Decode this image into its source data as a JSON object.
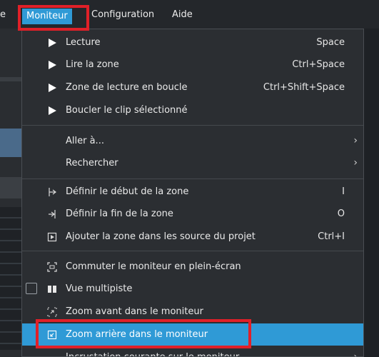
{
  "menubar": {
    "prev_label": "e",
    "active_label": "Moniteur",
    "config_label": "Configuration",
    "aide_label": "Aide"
  },
  "menu": {
    "items": [
      {
        "label": "Lecture",
        "shortcut": "Space",
        "icon": "play-icon"
      },
      {
        "label": "Lire la zone",
        "shortcut": "Ctrl+Space",
        "icon": "play-icon"
      },
      {
        "label": "Zone de lecture en boucle",
        "shortcut": "Ctrl+Shift+Space",
        "icon": "play-icon"
      },
      {
        "label": "Boucler le clip sélectionné",
        "shortcut": "",
        "icon": "play-icon"
      },
      {
        "label": "Aller à...",
        "submenu": true
      },
      {
        "label": "Rechercher",
        "submenu": true
      },
      {
        "label": "Définir le début de la zone",
        "shortcut": "I",
        "icon": "zone-start-icon"
      },
      {
        "label": "Définir la fin de la zone",
        "shortcut": "O",
        "icon": "zone-end-icon"
      },
      {
        "label": "Ajouter la zone dans les source du projet",
        "shortcut": "Ctrl+I",
        "icon": "add-zone-icon"
      },
      {
        "label": "Commuter le moniteur en plein-écran",
        "icon": "fullscreen-icon"
      },
      {
        "label": "Vue multipiste",
        "icon": "multitrack-icon",
        "checkbox": true
      },
      {
        "label": "Zoom avant dans le moniteur",
        "icon": "zoom-in-icon"
      },
      {
        "label": "Zoom arrière dans le moniteur",
        "icon": "zoom-out-icon",
        "highlighted": true
      },
      {
        "label": "Incrustation courante sur le moniteur",
        "submenu": true
      }
    ]
  },
  "colors": {
    "accent": "#2f9ad6",
    "annotation_red": "#e02028",
    "menu_bg": "#2b2e32"
  }
}
